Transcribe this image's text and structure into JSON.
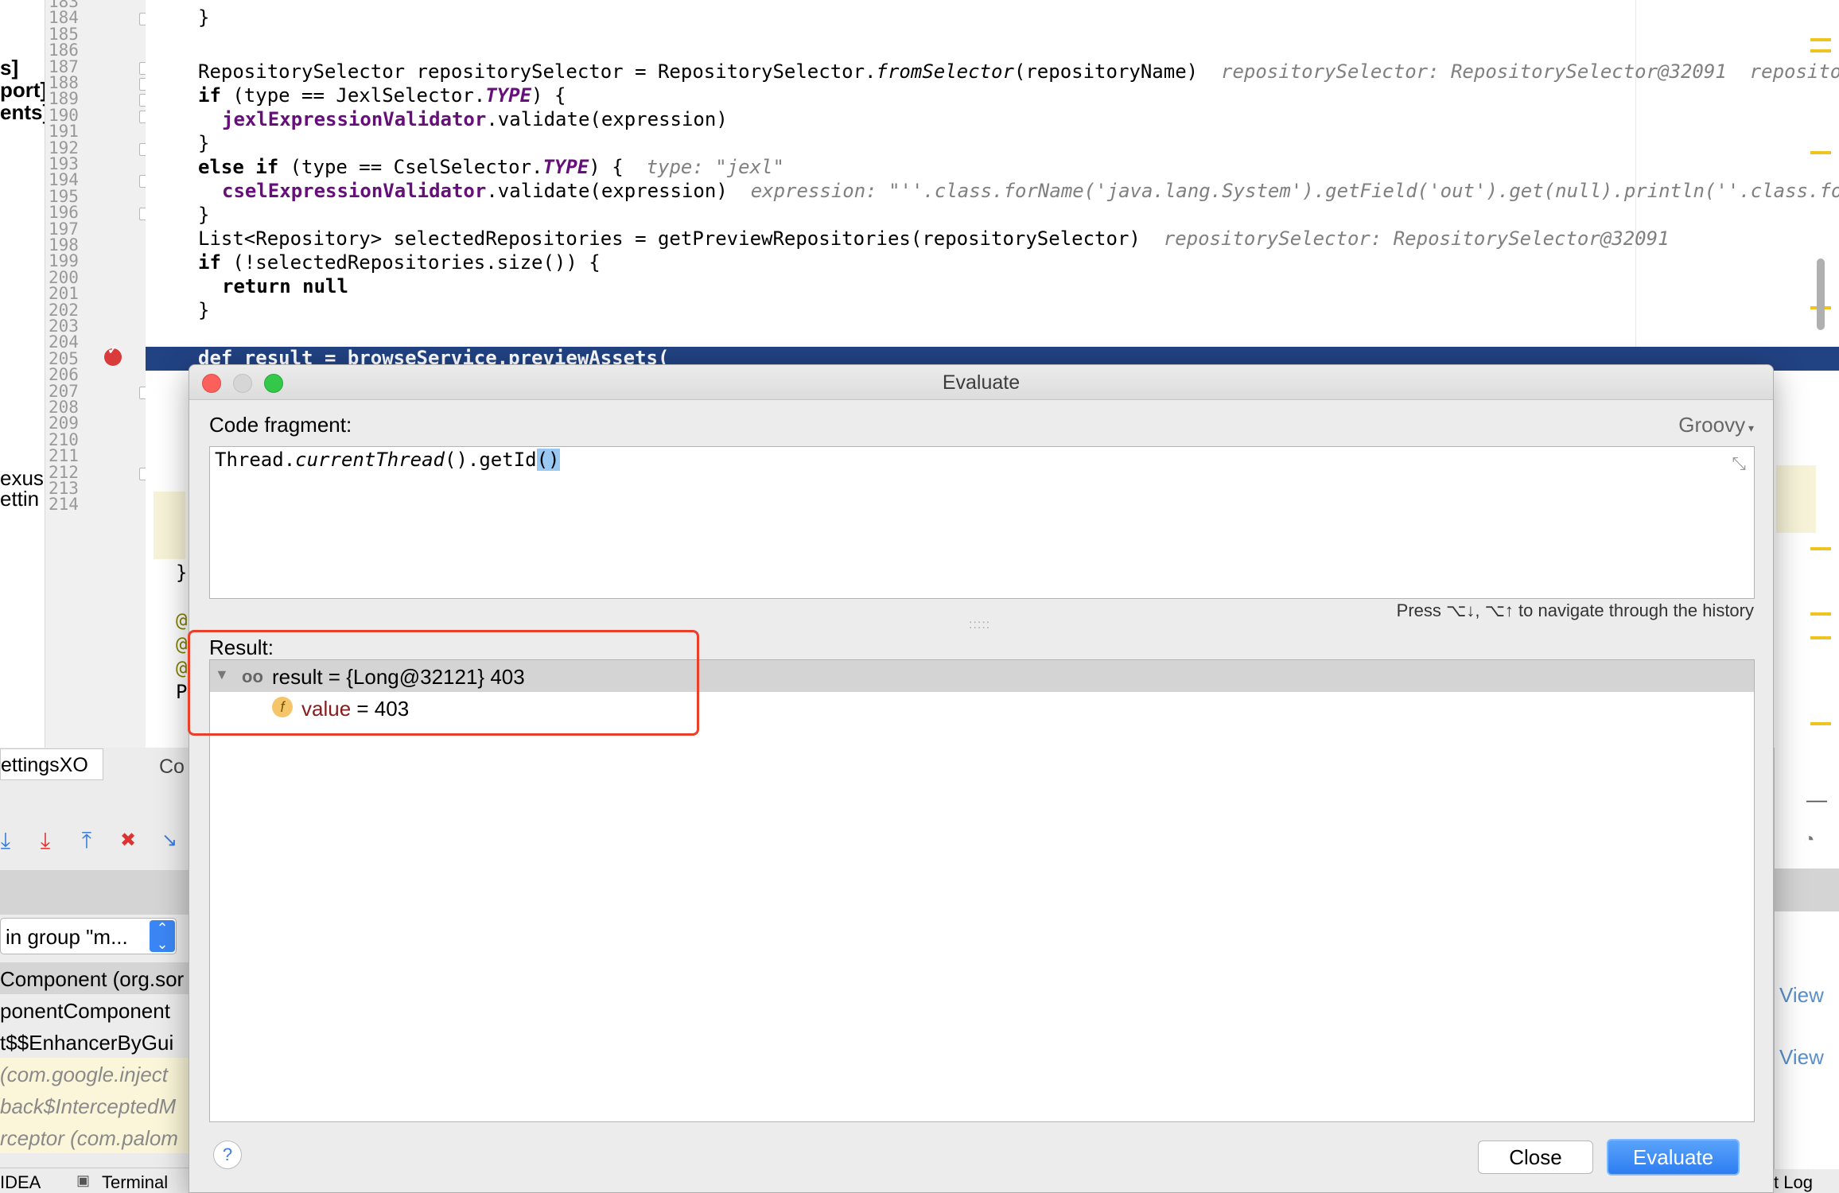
{
  "editor": {
    "left_fragments": [
      "s]",
      "port]",
      "ents]",
      "exus.",
      "ettin"
    ],
    "line_numbers": [
      "183",
      "184",
      "185",
      "186",
      "187",
      "188",
      "189",
      "190",
      "191",
      "192",
      "193",
      "194",
      "195",
      "196",
      "197",
      "198",
      "199",
      "200",
      "201",
      "202",
      "203",
      "204",
      "205",
      "206",
      "207",
      "208",
      "209",
      "210",
      "211",
      "212",
      "213",
      "214"
    ],
    "code": {
      "l184": "}",
      "l186_a": "RepositorySelector repositorySelector = RepositorySelector.",
      "l186_b": "fromSelector",
      "l186_c": "(repositoryName)",
      "l186_hint": "repositorySelector: RepositorySelector@32091  repositoryNa",
      "l187_kw": "if",
      "l187_a": " (type == JexlSelector.",
      "l187_b": "TYPE",
      "l187_c": ") {",
      "l188_fld": "jexlExpressionValidator",
      "l188_b": ".validate(expression)",
      "l189": "}",
      "l190_kw": "else if",
      "l190_a": " (type == CselSelector.",
      "l190_b": "TYPE",
      "l190_c": ") {",
      "l190_hint": "type: \"jexl\"",
      "l191_fld": "cselExpressionValidator",
      "l191_b": ".validate(expression)",
      "l191_hint": "expression: \"''.class.forName('java.lang.System').getField('out').get(null).println(''.class.forNam",
      "l192": "}",
      "l193_a": "List<Repository> selectedRepositories = getPreviewRepositories(repositorySelector)",
      "l193_hint": "repositorySelector: RepositorySelector@32091",
      "l194_kw": "if",
      "l194_a": " (!selectedRepositories.size()) {",
      "l195_kw": "return null",
      "l196": "}",
      "l198": "def result = browseService.previewAssets(",
      "l207": "}",
      "l209": "@",
      "l210": "@",
      "l211": "@",
      "l212": "P"
    }
  },
  "lower_panel": {
    "tab_label": "ettingsXO",
    "tab2_label": "Co",
    "thread_select": "in group \"m...",
    "frames": [
      "Component (org.sor",
      "ponentComponent",
      "t$$EnhancerByGui",
      "(com.google.inject",
      "back$InterceptedM",
      "rceptor (com.palom"
    ],
    "status_idea": "IDEA",
    "status_terminal": "Terminal",
    "status_log": "t Log"
  },
  "right_panel": {
    "link1": "View",
    "link2": "View"
  },
  "dialog": {
    "title": "Evaluate",
    "code_fragment_label": "Code fragment:",
    "language": "Groovy",
    "code_prefix": "Thread.",
    "code_method": "currentThread",
    "code_mid": "().getId",
    "code_paren": "()",
    "history_hint": "Press ⌥↓, ⌥↑ to navigate through the history",
    "result_label": "Result:",
    "result_text": "result = {Long@32121} 403",
    "value_name": "value",
    "value_rest": " = 403",
    "help_label": "?",
    "close_label": "Close",
    "evaluate_label": "Evaluate"
  },
  "colors": {
    "execution_line": "#214283",
    "highlight_box": "#e8402b",
    "evaluate_button": "#2d7df2",
    "field_name": "#871c1c",
    "keyword": "#000080"
  },
  "icons": [
    "breakpoint-icon",
    "watch-result-icon",
    "field-icon",
    "collapse-icon",
    "step-over-icon",
    "step-into-icon",
    "step-out-icon",
    "drop-frame-icon",
    "run-to-cursor-icon"
  ]
}
